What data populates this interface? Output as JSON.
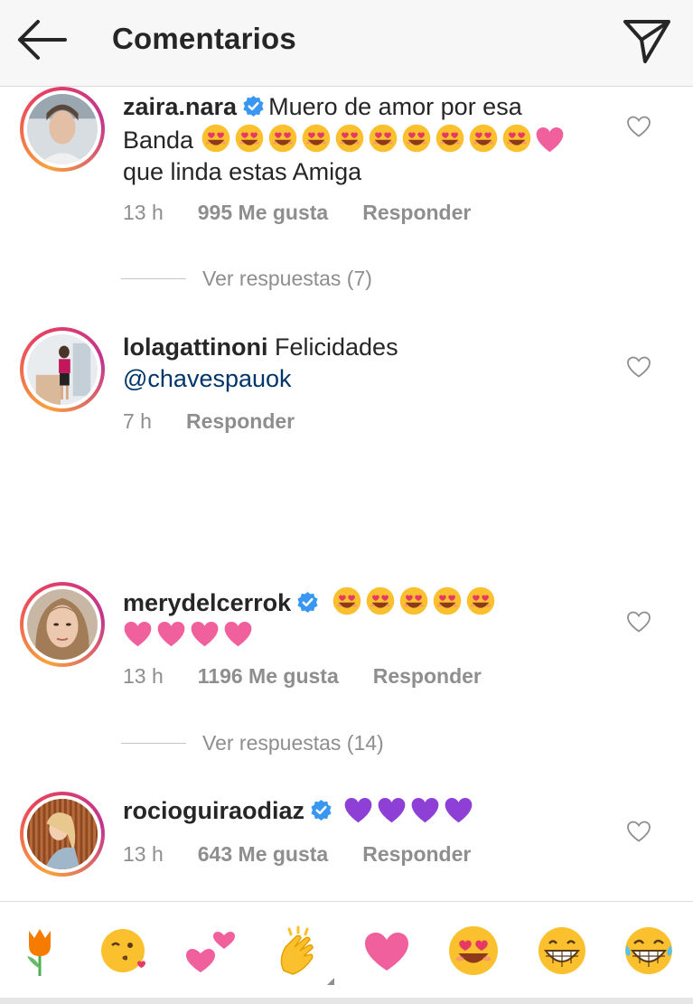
{
  "header": {
    "title": "Comentarios",
    "back_icon": "arrow-left-icon",
    "send_icon": "paper-plane-icon"
  },
  "comments": [
    {
      "username": "zaira.nara",
      "verified": true,
      "text_line1": "Muero de amor por esa",
      "text_line2": "Banda",
      "text_line3": "que linda estas Amiga",
      "time": "13 h",
      "likes": "995 Me gusta",
      "reply": "Responder",
      "view_replies": "Ver respuestas (7)"
    },
    {
      "username": "lolagattinoni",
      "verified": false,
      "text": "Felicidades",
      "mention": "@chavespauok",
      "time": "7 h",
      "reply": "Responder"
    },
    {
      "username": "merydelcerrok",
      "verified": true,
      "time": "13 h",
      "likes": "1196 Me gusta",
      "reply": "Responder",
      "view_replies": "Ver respuestas (14)"
    },
    {
      "username": "rocioguiraodiaz",
      "verified": true,
      "time": "13 h",
      "likes": "643 Me gusta",
      "reply": "Responder"
    }
  ],
  "quick_emojis": [
    "tulip",
    "face-blowing-kiss",
    "two-hearts",
    "clapping-hands",
    "heart",
    "heart-eyes-face",
    "grinning-face",
    "tears-of-joy-face"
  ],
  "colors": {
    "verified": "#3897f0",
    "mention": "#003569",
    "meta": "#8e8e8e",
    "heart": "#f0609c",
    "purple_heart": "#8e3fd6"
  }
}
